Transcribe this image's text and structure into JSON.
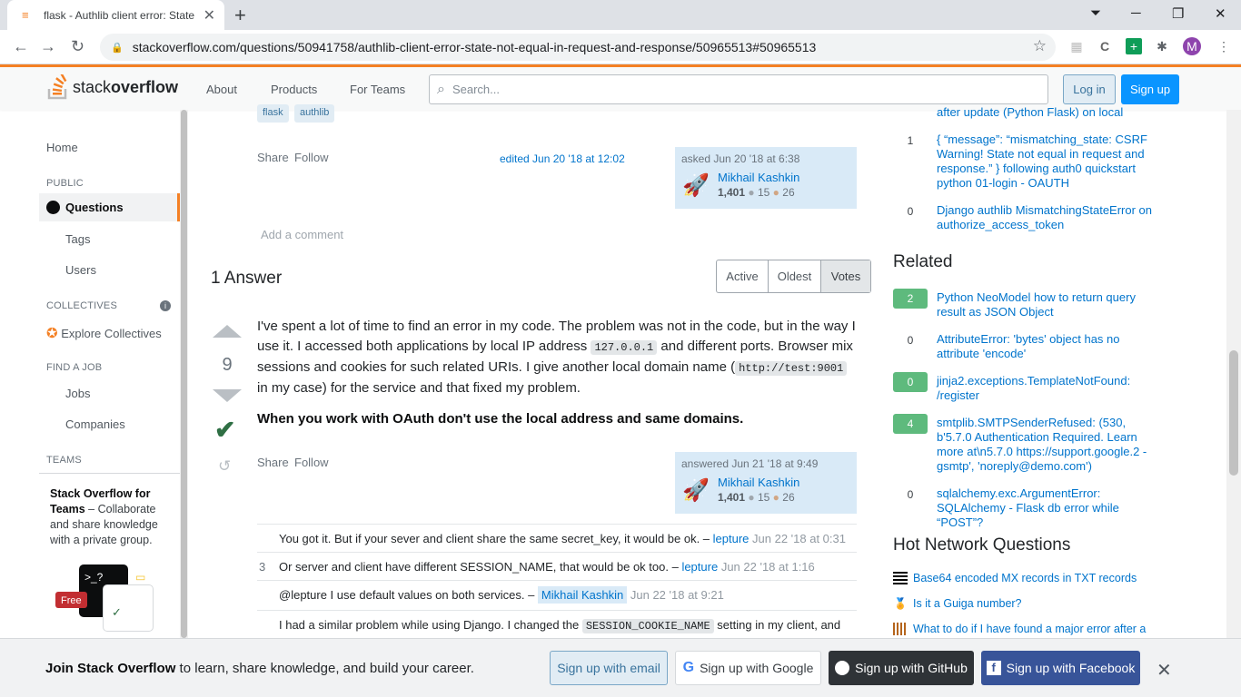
{
  "browser": {
    "tab_title": "flask - Authlib client error: State n",
    "url": "stackoverflow.com/questions/50941758/authlib-client-error-state-not-equal-in-request-and-response/50965513#50965513",
    "profile_initial": "M"
  },
  "topbar": {
    "logo_text_a": "stack",
    "logo_text_b": "overflow",
    "nav": [
      "About",
      "Products",
      "For Teams"
    ],
    "search_placeholder": "Search...",
    "login": "Log in",
    "signup": "Sign up"
  },
  "leftnav": {
    "home": "Home",
    "public_heading": "PUBLIC",
    "questions": "Questions",
    "tags": "Tags",
    "users": "Users",
    "collectives_heading": "COLLECTIVES",
    "explore_collectives": "Explore Collectives",
    "find_job_heading": "FIND A JOB",
    "jobs": "Jobs",
    "companies": "Companies",
    "teams_heading": "TEAMS",
    "teams_title": "Stack Overflow for Teams",
    "teams_body": " – Collaborate and share knowledge with a private group.",
    "free_badge": "Free",
    "teams_prompt": ">_?"
  },
  "question": {
    "tags": [
      "flask",
      "authlib"
    ],
    "share": "Share",
    "follow": "Follow",
    "edited": "edited Jun 20 '18 at 12:02",
    "asked": "asked Jun 20 '18 at 6:38",
    "user": "Mikhail Kashkin",
    "rep": "1,401",
    "silver": "15",
    "bronze": "26",
    "add_comment": "Add a comment"
  },
  "answers": {
    "count_label": "1 Answer",
    "sort": [
      "Active",
      "Oldest",
      "Votes"
    ],
    "votes": "9",
    "body_1": "I've spent a lot of time to find an error in my code. The problem was not in the code, but in the way I use it. I accessed both applications by local IP address ",
    "code_1": "127.0.0.1",
    "body_2": " and different ports. Browser mix sessions and cookies for such related URIs. I give another local domain name (",
    "code_2": "http://test:9001",
    "body_3": " in my case) for the service and that fixed my problem.",
    "bold": "When you work with OAuth don't use the local address and same domains.",
    "share": "Share",
    "follow": "Follow",
    "answered": "answered Jun 21 '18 at 9:49",
    "user": "Mikhail Kashkin",
    "rep": "1,401",
    "silver": "15",
    "bronze": "26"
  },
  "comments": [
    {
      "score": "",
      "text": "You got it. But if your sever and client share the same secret_key, it would be ok. – ",
      "user": "lepture",
      "date": "Jun 22 '18 at 0:31"
    },
    {
      "score": "3",
      "text": "Or server and client have different SESSION_NAME, that would be ok too. – ",
      "user": "lepture",
      "date": "Jun 22 '18 at 1:16"
    },
    {
      "score": "",
      "text": "@lepture I use default values on both services. – ",
      "user": "Mikhail Kashkin",
      "date": "Jun 22 '18 at 9:21"
    },
    {
      "score": "",
      "text_a": "I had a similar problem while using Django. I changed the ",
      "code": "SESSION_COOKIE_NAME",
      "text_b": " setting in my client, and"
    }
  ],
  "sidebar": {
    "linked_top_partial": "after update (Python Flask) on local",
    "linked": [
      {
        "votes": "1",
        "title": "{ “message”: “mismatching_state: CSRF Warning! State not equal in request and response.” } following auth0 quickstart python 01-login - OAUTH"
      },
      {
        "votes": "0",
        "title": "Django authlib MismatchingStateError on authorize_access_token"
      }
    ],
    "related_heading": "Related",
    "related": [
      {
        "votes": "2",
        "title": "Python NeoModel how to return query result as JSON Object",
        "answered": true
      },
      {
        "votes": "0",
        "title": "AttributeError: 'bytes' object has no attribute 'encode'",
        "answered": false
      },
      {
        "votes": "0",
        "title": "jinja2.exceptions.TemplateNotFound: /register",
        "answered": true
      },
      {
        "votes": "4",
        "title": "smtplib.SMTPSenderRefused: (530, b'5.7.0 Authentication Required. Learn more at\\n5.7.0 https://support.google.2 - gsmtp', 'noreply@demo.com')",
        "answered": true
      },
      {
        "votes": "0",
        "title": "sqlalchemy.exc.ArgumentError: SQLAlchemy - Flask db error while “POST”?",
        "answered": false
      }
    ],
    "hnq_heading": "Hot Network Questions",
    "hnq": [
      "Base64 encoded MX records in TXT records",
      "Is it a Guiga number?",
      "What to do if I have found a major error after a"
    ]
  },
  "signup_bar": {
    "lead_bold": "Join Stack Overflow",
    "lead_rest": " to learn, share knowledge, and build your career.",
    "email": "Sign up with email",
    "google": "Sign up with Google",
    "github": "Sign up with GitHub",
    "facebook": "Sign up with Facebook"
  },
  "colors": {
    "accent": "#f48024",
    "link": "#0074cc",
    "accepted": "#2f6f44",
    "answered_badge": "#5eba7d"
  }
}
